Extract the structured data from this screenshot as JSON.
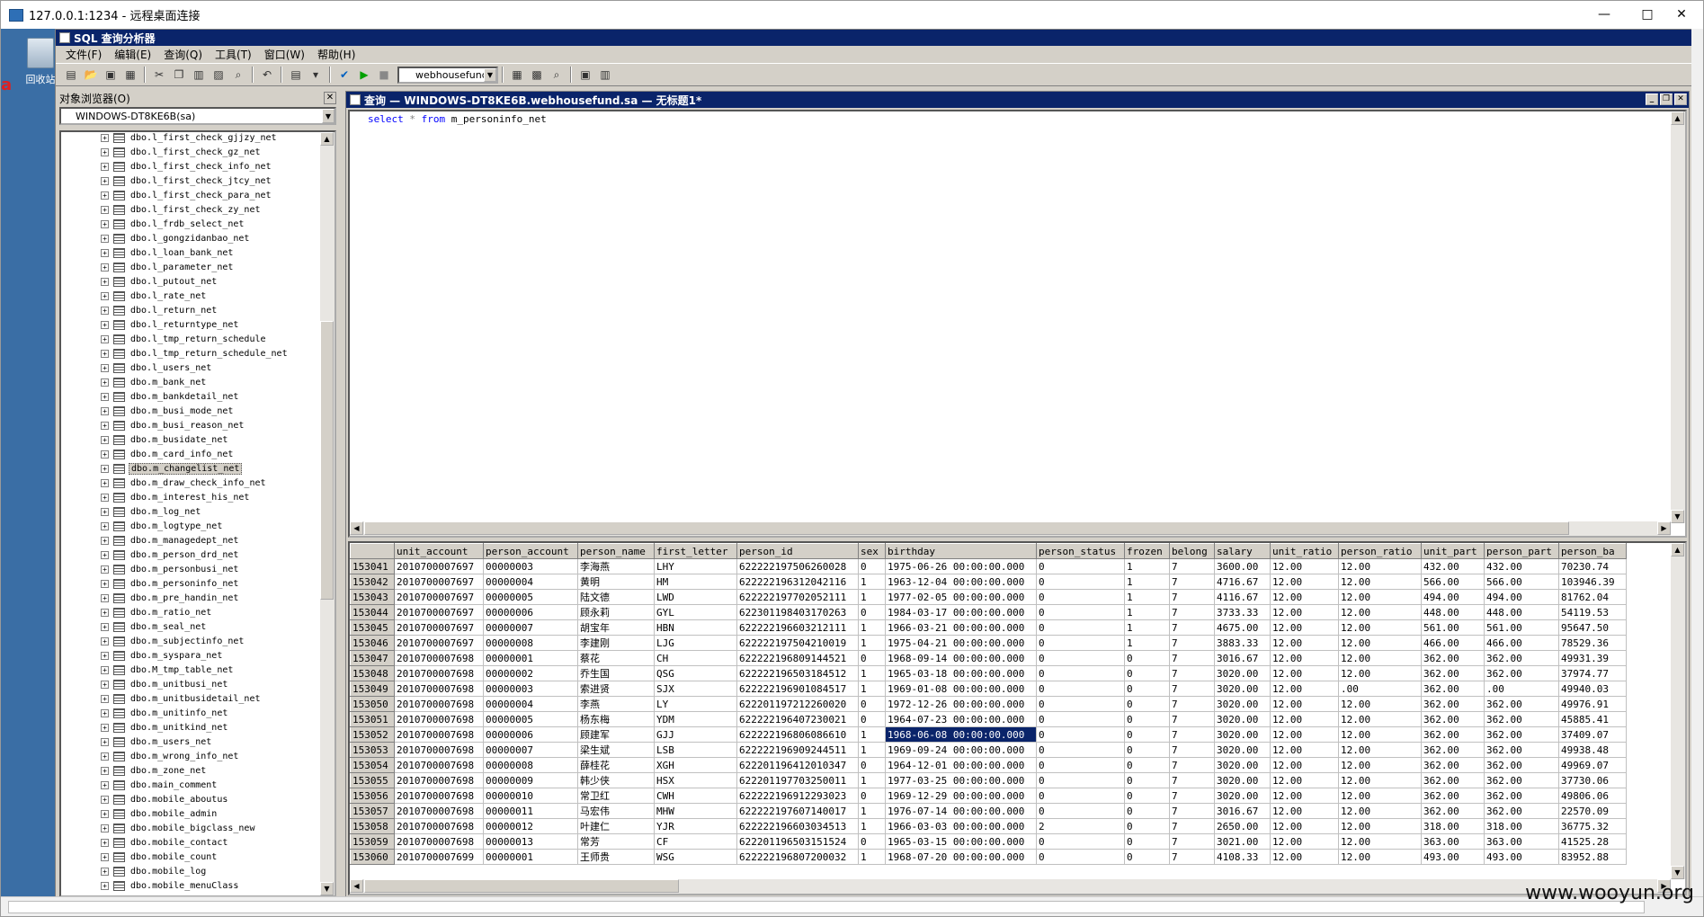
{
  "rdp": {
    "title": "127.0.0.1:1234 - 远程桌面连接",
    "min": "—",
    "max": "□",
    "close": "✕"
  },
  "desktop": {
    "icon_label": "回收站",
    "red_text": "a"
  },
  "app": {
    "title": "SQL 查询分析器",
    "menu": [
      "文件(F)",
      "编辑(E)",
      "查询(Q)",
      "工具(T)",
      "窗口(W)",
      "帮助(H)"
    ],
    "database": "webhousefund"
  },
  "object_browser": {
    "title": "对象浏览器(O)",
    "server": "WINDOWS-DT8KE6B(sa)",
    "tables": [
      "dbo.l_first_check_gjjzy_net",
      "dbo.l_first_check_gz_net",
      "dbo.l_first_check_info_net",
      "dbo.l_first_check_jtcy_net",
      "dbo.l_first_check_para_net",
      "dbo.l_first_check_zy_net",
      "dbo.l_frdb_select_net",
      "dbo.l_gongzidanbao_net",
      "dbo.l_loan_bank_net",
      "dbo.l_parameter_net",
      "dbo.l_putout_net",
      "dbo.l_rate_net",
      "dbo.l_return_net",
      "dbo.l_returntype_net",
      "dbo.l_tmp_return_schedule",
      "dbo.l_tmp_return_schedule_net",
      "dbo.l_users_net",
      "dbo.m_bank_net",
      "dbo.m_bankdetail_net",
      "dbo.m_busi_mode_net",
      "dbo.m_busi_reason_net",
      "dbo.m_busidate_net",
      "dbo.m_card_info_net",
      "dbo.m_changelist_net",
      "dbo.m_draw_check_info_net",
      "dbo.m_interest_his_net",
      "dbo.m_log_net",
      "dbo.m_logtype_net",
      "dbo.m_managedept_net",
      "dbo.m_person_drd_net",
      "dbo.m_personbusi_net",
      "dbo.m_personinfo_net",
      "dbo.m_pre_handin_net",
      "dbo.m_ratio_net",
      "dbo.m_seal_net",
      "dbo.m_subjectinfo_net",
      "dbo.m_syspara_net",
      "dbo.M_tmp_table_net",
      "dbo.m_unitbusi_net",
      "dbo.m_unitbusidetail_net",
      "dbo.m_unitinfo_net",
      "dbo.m_unitkind_net",
      "dbo.m_users_net",
      "dbo.m_wrong_info_net",
      "dbo.m_zone_net",
      "dbo.main_comment",
      "dbo.mobile_aboutus",
      "dbo.mobile_admin",
      "dbo.mobile_bigclass_new",
      "dbo.mobile_contact",
      "dbo.mobile_count",
      "dbo.mobile_log",
      "dbo.mobile_menuClass"
    ],
    "selected": "dbo.m_changelist_net"
  },
  "query": {
    "title": "查询 — WINDOWS-DT8KE6B.webhousefund.sa — 无标题1*",
    "sql_kw1": "select",
    "sql_star": "*",
    "sql_kw2": "from",
    "sql_table": "m_personinfo_net"
  },
  "results": {
    "columns": [
      "unit_account",
      "person_account",
      "person_name",
      "first_letter",
      "person_id",
      "sex",
      "birthday",
      "person_status",
      "frozen",
      "belong",
      "salary",
      "unit_ratio",
      "person_ratio",
      "unit_part",
      "person_part",
      "person_ba"
    ],
    "rows": [
      [
        "153041",
        "2010700007697",
        "00000003",
        "李海燕",
        "LHY",
        "622222197506260028",
        "0",
        "1975-06-26 00:00:00.000",
        "0",
        "1",
        "7",
        "3600.00",
        "12.00",
        "12.00",
        "432.00",
        "432.00",
        "70230.74"
      ],
      [
        "153042",
        "2010700007697",
        "00000004",
        "黄明",
        "HM",
        "622222196312042116",
        "1",
        "1963-12-04 00:00:00.000",
        "0",
        "1",
        "7",
        "4716.67",
        "12.00",
        "12.00",
        "566.00",
        "566.00",
        "103946.39"
      ],
      [
        "153043",
        "2010700007697",
        "00000005",
        "陆文德",
        "LWD",
        "622222197702052111",
        "1",
        "1977-02-05 00:00:00.000",
        "0",
        "1",
        "7",
        "4116.67",
        "12.00",
        "12.00",
        "494.00",
        "494.00",
        "81762.04"
      ],
      [
        "153044",
        "2010700007697",
        "00000006",
        "顾永莉",
        "GYL",
        "622301198403170263",
        "0",
        "1984-03-17 00:00:00.000",
        "0",
        "1",
        "7",
        "3733.33",
        "12.00",
        "12.00",
        "448.00",
        "448.00",
        "54119.53"
      ],
      [
        "153045",
        "2010700007697",
        "00000007",
        "胡宝年",
        "HBN",
        "622222196603212111",
        "1",
        "1966-03-21 00:00:00.000",
        "0",
        "1",
        "7",
        "4675.00",
        "12.00",
        "12.00",
        "561.00",
        "561.00",
        "95647.50"
      ],
      [
        "153046",
        "2010700007697",
        "00000008",
        "李建刚",
        "LJG",
        "622222197504210019",
        "1",
        "1975-04-21 00:00:00.000",
        "0",
        "1",
        "7",
        "3883.33",
        "12.00",
        "12.00",
        "466.00",
        "466.00",
        "78529.36"
      ],
      [
        "153047",
        "2010700007698",
        "00000001",
        "蔡花",
        "CH",
        "622222196809144521",
        "0",
        "1968-09-14 00:00:00.000",
        "0",
        "0",
        "7",
        "3016.67",
        "12.00",
        "12.00",
        "362.00",
        "362.00",
        "49931.39"
      ],
      [
        "153048",
        "2010700007698",
        "00000002",
        "乔生国",
        "QSG",
        "622222196503184512",
        "1",
        "1965-03-18 00:00:00.000",
        "0",
        "0",
        "7",
        "3020.00",
        "12.00",
        "12.00",
        "362.00",
        "362.00",
        "37974.77"
      ],
      [
        "153049",
        "2010700007698",
        "00000003",
        "索进贤",
        "SJX",
        "622222196901084517",
        "1",
        "1969-01-08 00:00:00.000",
        "0",
        "0",
        "7",
        "3020.00",
        "12.00",
        ".00",
        "362.00",
        ".00",
        "49940.03"
      ],
      [
        "153050",
        "2010700007698",
        "00000004",
        "李燕",
        "LY",
        "622201197212260020",
        "0",
        "1972-12-26 00:00:00.000",
        "0",
        "0",
        "7",
        "3020.00",
        "12.00",
        "12.00",
        "362.00",
        "362.00",
        "49976.91"
      ],
      [
        "153051",
        "2010700007698",
        "00000005",
        "杨东梅",
        "YDM",
        "622222196407230021",
        "0",
        "1964-07-23 00:00:00.000",
        "0",
        "0",
        "7",
        "3020.00",
        "12.00",
        "12.00",
        "362.00",
        "362.00",
        "45885.41"
      ],
      [
        "153052",
        "2010700007698",
        "00000006",
        "顾建军",
        "GJJ",
        "622222196806086610",
        "1",
        "1968-06-08 00:00:00.000",
        "0",
        "0",
        "7",
        "3020.00",
        "12.00",
        "12.00",
        "362.00",
        "362.00",
        "37409.07"
      ],
      [
        "153053",
        "2010700007698",
        "00000007",
        "梁生斌",
        "LSB",
        "622222196909244511",
        "1",
        "1969-09-24 00:00:00.000",
        "0",
        "0",
        "7",
        "3020.00",
        "12.00",
        "12.00",
        "362.00",
        "362.00",
        "49938.48"
      ],
      [
        "153054",
        "2010700007698",
        "00000008",
        "薛桂花",
        "XGH",
        "622201196412010347",
        "0",
        "1964-12-01 00:00:00.000",
        "0",
        "0",
        "7",
        "3020.00",
        "12.00",
        "12.00",
        "362.00",
        "362.00",
        "49969.07"
      ],
      [
        "153055",
        "2010700007698",
        "00000009",
        "韩少侠",
        "HSX",
        "622201197703250011",
        "1",
        "1977-03-25 00:00:00.000",
        "0",
        "0",
        "7",
        "3020.00",
        "12.00",
        "12.00",
        "362.00",
        "362.00",
        "37730.06"
      ],
      [
        "153056",
        "2010700007698",
        "00000010",
        "常卫红",
        "CWH",
        "622222196912293023",
        "0",
        "1969-12-29 00:00:00.000",
        "0",
        "0",
        "7",
        "3020.00",
        "12.00",
        "12.00",
        "362.00",
        "362.00",
        "49806.06"
      ],
      [
        "153057",
        "2010700007698",
        "00000011",
        "马宏伟",
        "MHW",
        "622222197607140017",
        "1",
        "1976-07-14 00:00:00.000",
        "0",
        "0",
        "7",
        "3016.67",
        "12.00",
        "12.00",
        "362.00",
        "362.00",
        "22570.09"
      ],
      [
        "153058",
        "2010700007698",
        "00000012",
        "叶建仁",
        "YJR",
        "622222196603034513",
        "1",
        "1966-03-03 00:00:00.000",
        "2",
        "0",
        "7",
        "2650.00",
        "12.00",
        "12.00",
        "318.00",
        "318.00",
        "36775.32"
      ],
      [
        "153059",
        "2010700007698",
        "00000013",
        "常芳",
        "CF",
        "622201196503151524",
        "0",
        "1965-03-15 00:00:00.000",
        "0",
        "0",
        "7",
        "3021.00",
        "12.00",
        "12.00",
        "363.00",
        "363.00",
        "41525.28"
      ],
      [
        "153060",
        "2010700007699",
        "00000001",
        "王师贵",
        "WSG",
        "622222196807200032",
        "1",
        "1968-07-20 00:00:00.000",
        "0",
        "0",
        "7",
        "4108.33",
        "12.00",
        "12.00",
        "493.00",
        "493.00",
        "83952.88"
      ]
    ],
    "selected_cell": "1968-06-08 00:00:00.000"
  },
  "watermark": "www.wooyun.org"
}
